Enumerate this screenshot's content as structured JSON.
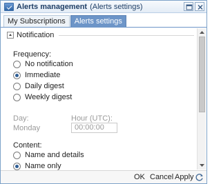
{
  "window": {
    "title": "Alerts management",
    "subtitle": "(Alerts settings)"
  },
  "tabs": [
    "My Subscriptions",
    "Alerts settings"
  ],
  "section": {
    "title": "Notification"
  },
  "frequency": {
    "label": "Frequency:",
    "options": [
      "No notification",
      "Immediate",
      "Daily digest",
      "Weekly digest"
    ],
    "selected": "Immediate"
  },
  "day": {
    "label": "Day:",
    "value": "Monday"
  },
  "hour": {
    "label": "Hour (UTC):",
    "value": "00:00:00"
  },
  "content": {
    "label": "Content:",
    "options": [
      "Name and details",
      "Name only"
    ],
    "selected": "Name only"
  },
  "footer": {
    "ok": "OK",
    "cancel": "Cancel",
    "apply": "Apply"
  }
}
